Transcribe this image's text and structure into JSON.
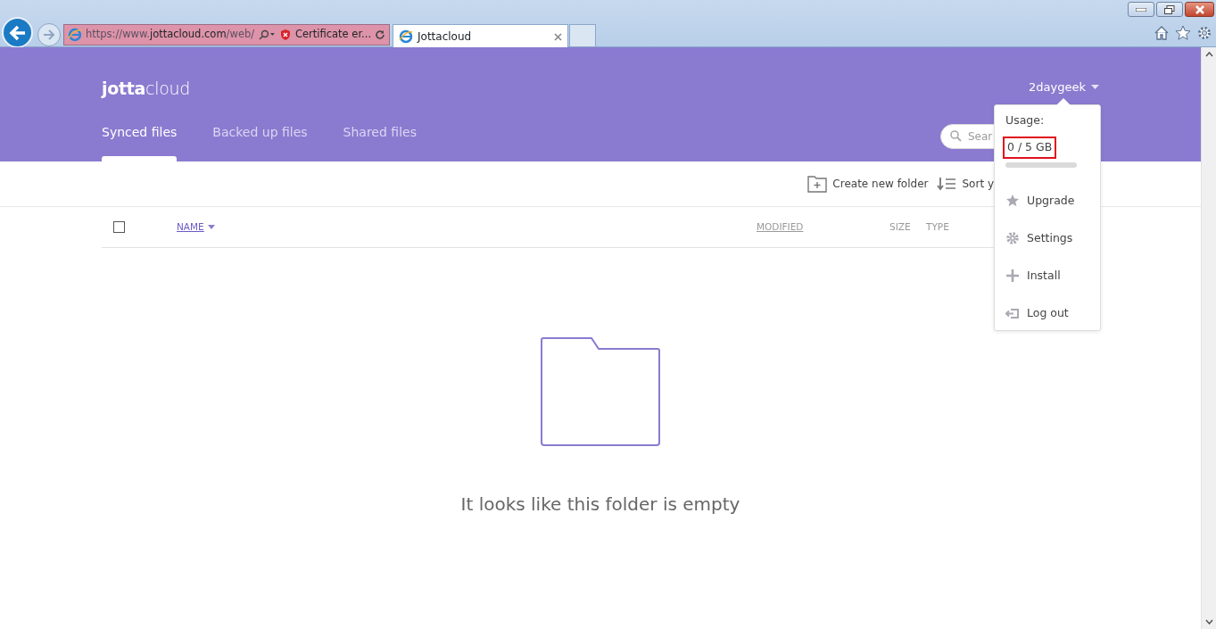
{
  "browser": {
    "address": {
      "parts": [
        {
          "text": "https://www.",
          "dim": true
        },
        {
          "text": "jottacloud.com",
          "dim": false
        },
        {
          "text": "/web/",
          "dim": true
        }
      ],
      "certificate_error": "Certificate er..."
    },
    "tabs": [
      {
        "label": "Jottacloud",
        "selected": true
      }
    ]
  },
  "header": {
    "logo": {
      "bold": "jotta",
      "light": "cloud"
    },
    "user": "2daygeek",
    "nav": [
      {
        "label": "Synced files",
        "selected": true
      },
      {
        "label": "Backed up files",
        "selected": false
      },
      {
        "label": "Shared files",
        "selected": false
      }
    ],
    "search": {
      "placeholder": "Sear"
    }
  },
  "toolbar": {
    "create": "Create new folder",
    "sort": "Sort y"
  },
  "table": {
    "select_all": {
      "checked": false
    },
    "columns": [
      {
        "label": "NAME",
        "sorted": true,
        "link": true
      },
      {
        "label": "MODIFIED",
        "sorted": false,
        "link": true
      },
      {
        "label": "SIZE",
        "sorted": false,
        "link": false
      },
      {
        "label": "TYPE",
        "sorted": false,
        "link": false
      }
    ]
  },
  "empty_message": "It looks like this folder is empty",
  "user_menu": {
    "usage_label": "Usage:",
    "usage_value": "0 / 5 GB",
    "highlighted": true,
    "level": 0,
    "items": [
      {
        "kind": "star",
        "label": "Upgrade"
      },
      {
        "kind": "gear",
        "label": "Settings"
      },
      {
        "kind": "plus",
        "label": "Install"
      },
      {
        "kind": "logout",
        "label": "Log out"
      }
    ]
  }
}
